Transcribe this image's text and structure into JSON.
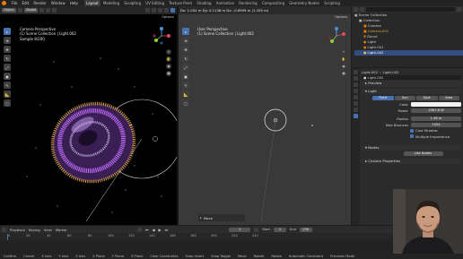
{
  "menubar": {
    "menus": [
      "File",
      "Edit",
      "Render",
      "Window",
      "Help"
    ],
    "workspaces": [
      "Layout",
      "Modeling",
      "Sculpting",
      "UV Editing",
      "Texture Paint",
      "Shading",
      "Animation",
      "Rendering",
      "Compositing",
      "Geometry Nodes",
      "Scripting"
    ],
    "active_workspace": "Layout"
  },
  "left_viewport": {
    "mode": "Object",
    "orientation": "Global",
    "options": "Options",
    "info": [
      "Camera Perspective",
      "(1) Scene Collection | Light.002",
      "Sample 8/200"
    ]
  },
  "right_viewport": {
    "header_transform": "Dx: 1.004 m   Dy: 0.1138 m   Dz: -0.6599 m (1.205 m)",
    "options": "Options",
    "info": [
      "User Perspective",
      "(1) Scene Collection | Light.002"
    ],
    "operator_panel": "Move"
  },
  "outliner": {
    "title": "Scene Collection",
    "items": [
      "Collection",
      "Camera",
      "Camera.001",
      "Donut",
      "Light",
      "Light.001",
      "Light.002"
    ]
  },
  "properties": {
    "object_name": "Light.002",
    "data_name": "Light.002",
    "panels": {
      "preview": "Preview",
      "light": "Light",
      "nodes": "Nodes",
      "custom": "Custom Properties"
    },
    "light_types": [
      "Point",
      "Sun",
      "Spot",
      "Area"
    ],
    "active_light_type": "Point",
    "fields": [
      {
        "label": "Color",
        "value": ""
      },
      {
        "label": "Power",
        "value": "3367.8 W"
      },
      {
        "label": "Radius",
        "value": "1.46 m"
      },
      {
        "label": "Max Bounces",
        "value": "1024"
      }
    ],
    "checks": [
      "Cast Shadow",
      "Multiple Importance"
    ],
    "use_nodes": "Use Nodes",
    "color_swatch": "#f2f2f2"
  },
  "timeline": {
    "menus": [
      "Playback",
      "Keying",
      "View",
      "Marker"
    ],
    "current_frame": "1",
    "start_label": "Start",
    "start": "1",
    "end_label": "End",
    "end": "250",
    "frame_marks": [
      "0",
      "20",
      "40",
      "60",
      "80",
      "100",
      "120",
      "140",
      "160",
      "180",
      "200",
      "220",
      "240"
    ]
  },
  "statusbar": {
    "items": [
      "Confirm",
      "Cancel",
      "X Axis",
      "Y Axis",
      "Z Axis",
      "X Plane",
      "Y Plane",
      "Z Plane",
      "Clear Constraints",
      "Snap Invert",
      "Snap Toggle",
      "Move",
      "Rotate",
      "Resize",
      "Automatic Constraint",
      "Precision Mode"
    ]
  },
  "colors": {
    "accent_blue": "#4772b3",
    "blender_orange": "#e87d0d",
    "point_cloud_purple": "#9b4fd8",
    "point_cloud_orange": "#d9a441"
  }
}
